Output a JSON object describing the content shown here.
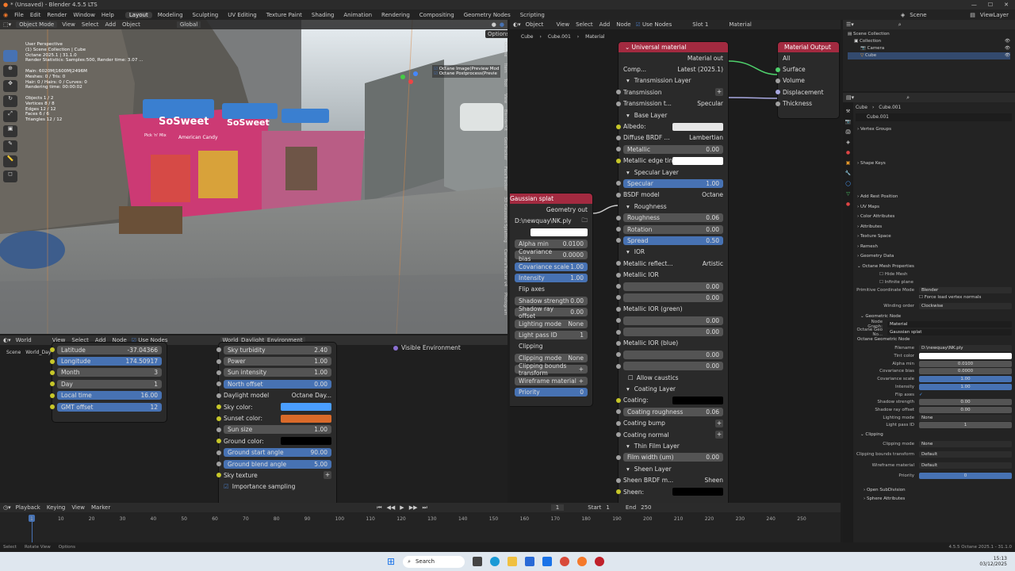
{
  "app": {
    "title": "* (Unsaved) - Blender 4.5.5 LTS"
  },
  "menu": [
    "File",
    "Edit",
    "Render",
    "Window",
    "Help"
  ],
  "workspaces": [
    "Layout",
    "Modeling",
    "Sculpting",
    "UV Editing",
    "Texture Paint",
    "Shading",
    "Animation",
    "Rendering",
    "Compositing",
    "Geometry Nodes",
    "Scripting"
  ],
  "top_right": {
    "scene": "Scene",
    "view_layer": "ViewLayer"
  },
  "viewport": {
    "mode": "Object Mode",
    "menus": [
      "View",
      "Select",
      "Add",
      "Object"
    ],
    "orientation": "Global",
    "options": "Options",
    "overlay_lines": [
      "User Perspective",
      "(1) Scene Collection | Cube",
      "Octane 2025.1 | 31.1.0",
      "Render Statistics: Samples:500, Render time: 3.07 ...",
      "",
      "Main: 6020M|1600M|2496M",
      "Meshes: 0 / Tris: 0",
      "Hair: 0 / Hairs: 0 / Curves: 0",
      "Rendering time: 00:00:02",
      "",
      "Objects  1 / 2",
      "Vertices  8 / 8",
      "Edges  12 / 12",
      "Faces  6 / 6",
      "Triangles  12 / 12"
    ],
    "checks": [
      "Octane Image(Preview Mod",
      "Octane Postprocess(Previe"
    ],
    "side_tabs": [
      "Octane",
      "Item",
      "Tool",
      "View",
      "BlenderKit",
      "GeoTracker",
      "FaceTracker",
      "3D Gaussian Splatting",
      "CameraTracker v4",
      "Photogram"
    ],
    "sign1": "SoSweet",
    "sign2": "SoSweet",
    "sign3": "American Candy",
    "sign4": "Pick 'n' Mix"
  },
  "world_editor": {
    "type": "World",
    "menus": [
      "View",
      "Select",
      "Add",
      "Node"
    ],
    "use_nodes": "Use Nodes",
    "node_name": "World_Daylight_Environment",
    "tree": [
      "Scene",
      "World_Daylight_Environment"
    ],
    "loc_rows": [
      {
        "label": "Latitude",
        "value": "-37.04366",
        "hl": false
      },
      {
        "label": "Longitude",
        "value": "174.50917",
        "hl": true
      },
      {
        "label": "Month",
        "value": "3",
        "hl": false
      },
      {
        "label": "Day",
        "value": "1",
        "hl": false
      },
      {
        "label": "Local time",
        "value": "16.00",
        "hl": true
      },
      {
        "label": "GMT offset",
        "value": "12",
        "hl": true
      }
    ],
    "sky_rows": [
      {
        "label": "Sky turbidity",
        "value": "2.40",
        "hl": false
      },
      {
        "label": "Power",
        "value": "1.00",
        "hl": false
      },
      {
        "label": "Sun intensity",
        "value": "1.00",
        "hl": false
      },
      {
        "label": "North offset",
        "value": "0.00",
        "hl": true
      }
    ],
    "daylight_model_label": "Daylight model",
    "daylight_model": "Octane Day...",
    "sky_color": "Sky color:",
    "sunset_color": "Sunset color:",
    "sun_size": "Sun size",
    "sun_size_v": "1.00",
    "ground_color": "Ground color:",
    "ground_start": "Ground start angle",
    "ground_start_v": "90.00",
    "ground_blend": "Ground blend angle",
    "ground_blend_v": "5.00",
    "sky_texture": "Sky texture",
    "importance": "Importance sampling",
    "visible_env": "Visible Environment",
    "colors": {
      "sky": "#4a9eff",
      "sunset": "#d96a2a",
      "ground": "#000000"
    }
  },
  "node_editor": {
    "type": "Object",
    "menus": [
      "View",
      "Select",
      "Add",
      "Node"
    ],
    "use_nodes": "Use Nodes",
    "slot": "Slot 1",
    "material": "Material",
    "crumbs": [
      "Cube",
      "Cube.001",
      "Material"
    ]
  },
  "splat_node": {
    "title": "Gaussian splat",
    "out": "Geometry out",
    "file": "D:\\newquay\\NK.ply",
    "rows": [
      {
        "l": "Alpha min",
        "v": "0.0100",
        "hl": false
      },
      {
        "l": "Covariance bias",
        "v": "0.0000",
        "hl": false
      },
      {
        "l": "Covariance scale",
        "v": "1.00",
        "hl": true
      },
      {
        "l": "Intensity",
        "v": "1.00",
        "hl": true
      },
      {
        "l": "Flip axes",
        "v": "",
        "hl": false
      },
      {
        "l": "Shadow strength",
        "v": "0.00",
        "hl": false
      },
      {
        "l": "Shadow ray offset",
        "v": "0.00",
        "hl": false
      },
      {
        "l": "Lighting mode",
        "v": "None",
        "hl": false
      },
      {
        "l": "Light pass ID",
        "v": "1",
        "hl": false
      },
      {
        "l": "Clipping",
        "v": "",
        "hl": false
      },
      {
        "l": "Clipping mode",
        "v": "None",
        "hl": false
      },
      {
        "l": "Clipping bounds transform",
        "v": "+",
        "hl": false
      },
      {
        "l": "Wireframe material",
        "v": "+",
        "hl": false
      },
      {
        "l": "Priority",
        "v": "0",
        "hl": true
      }
    ]
  },
  "universal": {
    "title": "Universal material",
    "out": "Material out",
    "comp": "Comp...",
    "comp_v": "Latest (2025.1)",
    "rows": [
      {
        "t": "sec",
        "l": "Transmission Layer"
      },
      {
        "t": "plus",
        "l": "Transmission"
      },
      {
        "t": "drop",
        "l": "Transmission t...",
        "v": "Specular"
      },
      {
        "t": "sec",
        "l": "Base Layer"
      },
      {
        "t": "color",
        "l": "Albedo:",
        "c": "#e6e6e6"
      },
      {
        "t": "drop",
        "l": "Diffuse BRDF ...",
        "v": "Lambertian"
      },
      {
        "t": "val",
        "l": "Metallic",
        "v": "0.00"
      },
      {
        "t": "color",
        "l": "Metallic edge tint:",
        "c": "#ffffff"
      },
      {
        "t": "sec",
        "l": "Specular Layer"
      },
      {
        "t": "bval",
        "l": "Specular",
        "v": "1.00"
      },
      {
        "t": "drop",
        "l": "BSDF model",
        "v": "Octane"
      },
      {
        "t": "sec",
        "l": "Roughness"
      },
      {
        "t": "val",
        "l": "Roughness",
        "v": "0.06"
      },
      {
        "t": "val",
        "l": "Rotation",
        "v": "0.00"
      },
      {
        "t": "bval",
        "l": "Spread",
        "v": "0.50"
      },
      {
        "t": "sec",
        "l": "IOR"
      },
      {
        "t": "drop",
        "l": "Metallic reflect...",
        "v": "Artistic"
      },
      {
        "t": "lbl",
        "l": "Metallic IOR"
      },
      {
        "t": "val",
        "l": "",
        "v": "0.00"
      },
      {
        "t": "val",
        "l": "",
        "v": "0.00"
      },
      {
        "t": "lbl",
        "l": "Metallic IOR (green)"
      },
      {
        "t": "val",
        "l": "",
        "v": "0.00"
      },
      {
        "t": "val",
        "l": "",
        "v": "0.00"
      },
      {
        "t": "lbl",
        "l": "Metallic IOR (blue)"
      },
      {
        "t": "val",
        "l": "",
        "v": "0.00"
      },
      {
        "t": "val",
        "l": "",
        "v": "0.00"
      },
      {
        "t": "chk",
        "l": "Allow caustics"
      },
      {
        "t": "sec",
        "l": "Coating Layer"
      },
      {
        "t": "color",
        "l": "Coating:",
        "c": "#000000"
      },
      {
        "t": "val",
        "l": "Coating roughness",
        "v": "0.06"
      },
      {
        "t": "plus",
        "l": "Coating bump"
      },
      {
        "t": "plus",
        "l": "Coating normal"
      },
      {
        "t": "sec",
        "l": "Thin Film Layer"
      },
      {
        "t": "val",
        "l": "Film width (um)",
        "v": "0.00"
      },
      {
        "t": "sec",
        "l": "Sheen Layer"
      },
      {
        "t": "drop",
        "l": "Sheen BRDF m...",
        "v": "Sheen"
      },
      {
        "t": "color",
        "l": "Sheen:",
        "c": "#000000"
      }
    ]
  },
  "mat_output": {
    "title": "Material Output",
    "target": "All",
    "sockets": [
      "Surface",
      "Volume",
      "Displacement",
      "Thickness"
    ]
  },
  "outliner": {
    "root": "Scene Collection",
    "items": [
      "Collection",
      "Camera",
      "Cube"
    ]
  },
  "properties": {
    "crumbs": [
      "Cube",
      "Cube.001"
    ],
    "mesh": "Cube.001",
    "panels": [
      "Vertex Groups",
      "Shape Keys",
      "Add Rest Position",
      "UV Maps",
      "Color Attributes",
      "Attributes",
      "Texture Space",
      "Remesh",
      "Geometry Data",
      "Octane Mesh Properties"
    ],
    "hide_mesh": "Hide Mesh",
    "infinite_plane": "Infinite plane",
    "prim_coord": "Primitive Coordinate Mode",
    "prim_coord_v": "Blender",
    "force_load": "Force load vertex normals",
    "winding": "Winding order",
    "winding_v": "Clockwise",
    "geo_node": "Geometric Node",
    "node_graph": "Node Graph:",
    "node_graph_v": "Material",
    "octane_geo": "Octane Geo No...",
    "octane_geo_v": "Gaussian splat",
    "octane_geo_node": "Octane Geometric Node",
    "props": [
      {
        "k": "Filename",
        "v": "D:\\newquay\\NK.ply",
        "s": "f"
      },
      {
        "k": "Tint color",
        "v": "",
        "s": "w"
      },
      {
        "k": "Alpha min",
        "v": "0.0100",
        "s": "n"
      },
      {
        "k": "Covariance bias",
        "v": "0.0000",
        "s": "n"
      },
      {
        "k": "Covariance scale",
        "v": "1.00",
        "s": "b"
      },
      {
        "k": "Intensity",
        "v": "1.00",
        "s": "b"
      },
      {
        "k": "Flip axes",
        "v": "✓",
        "s": "c"
      },
      {
        "k": "Shadow strength",
        "v": "0.00",
        "s": "n"
      },
      {
        "k": "Shadow ray offset",
        "v": "0.00",
        "s": "n"
      },
      {
        "k": "Lighting mode",
        "v": "None",
        "s": "d"
      },
      {
        "k": "Light pass ID",
        "v": "1",
        "s": "n"
      }
    ],
    "clipping": "Clipping",
    "clip": [
      {
        "k": "Clipping mode",
        "v": "None"
      },
      {
        "k": "Clipping bounds transform",
        "v": "Default"
      },
      {
        "k": "Wireframe material",
        "v": "Default"
      },
      {
        "k": "Priority",
        "v": "0"
      }
    ],
    "open_subdiv": "Open SubDivision",
    "sphere_attr": "Sphere Attributes"
  },
  "timeline": {
    "menus": [
      "Playback",
      "Keying",
      "View",
      "Marker"
    ],
    "frame": "1",
    "start_label": "Start",
    "start": "1",
    "end_label": "End",
    "end": "250",
    "ticks": [
      "1",
      "10",
      "20",
      "30",
      "40",
      "50",
      "60",
      "70",
      "80",
      "90",
      "100",
      "110",
      "120",
      "130",
      "140",
      "150",
      "160",
      "170",
      "180",
      "190",
      "200",
      "210",
      "220",
      "230",
      "240",
      "250"
    ]
  },
  "status": {
    "left": [
      "Select",
      "Rotate View",
      "Options"
    ],
    "right": "4.5.5   Octane 2025.1 - 31.1.0"
  },
  "taskbar": {
    "search": "Search",
    "time": "15:13",
    "date": "03/12/2025"
  }
}
